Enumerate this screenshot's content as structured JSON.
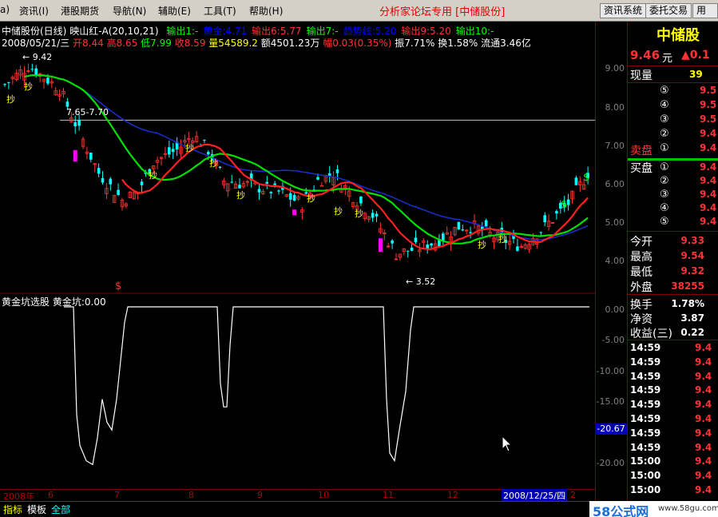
{
  "menu": {
    "items": [
      "a)",
      "资讯(I)",
      "港股期货",
      "导航(N)",
      "辅助(E)",
      "工具(T)",
      "帮助(H)"
    ],
    "forum_title": "分析家论坛专用 [中储股份]",
    "buttons": [
      "资讯系统",
      "委托交易",
      "用户"
    ]
  },
  "header": {
    "stock_name": "中储股份(日线)",
    "indicator_name": "映山红-A(20,10,21)",
    "outputs": [
      {
        "label": "输出1:-",
        "color": "#00ff00"
      },
      {
        "label": "黄金:4.71",
        "color": "#0000ff"
      },
      {
        "label": "输出6:5.77",
        "color": "#ff3333"
      },
      {
        "label": "输出7:-",
        "color": "#00ff00"
      },
      {
        "label": "趋势线:5.20",
        "color": "#0000ff"
      },
      {
        "label": "输出9:5.20",
        "color": "#ff3333"
      },
      {
        "label": "输出10:-",
        "color": "#00ff00"
      }
    ],
    "date": "2008/05/21/三",
    "open": "开8.44",
    "high": "高8.65",
    "low": "低7.99",
    "close": "收8.59",
    "volume": "量54589.2",
    "amount": "额4501.23万",
    "change": "幅0.03(0.35%)",
    "amplitude": "振7.71%",
    "turnover": "换1.58%",
    "float_shares": "流通3.46亿"
  },
  "price_chart": {
    "y_ticks": [
      "9.00",
      "8.00",
      "7.00",
      "6.00",
      "5.00",
      "4.00"
    ],
    "high_label": "9.42",
    "low_label": "3.52",
    "range_label": "7.65-7.70",
    "signal_text": "抄",
    "dollar": "$"
  },
  "indicator": {
    "title": "黄金坑选股",
    "value_label": "黄金坑:0.00",
    "y_ticks": [
      "0.00",
      "-5.00",
      "-10.00",
      "-15.00",
      "-20.00"
    ],
    "current_value": "-20.67"
  },
  "x_axis": {
    "labels": [
      "2008年",
      "6",
      "7",
      "8",
      "9",
      "10",
      "11",
      "12",
      "2"
    ],
    "cursor_date": "2008/12/25/四"
  },
  "bottom": {
    "tabs": [
      "指标",
      "模板",
      "全部"
    ],
    "watermark": "58公式网",
    "watermark_url": "www.58gu.com"
  },
  "quote": {
    "name": "中储股",
    "price": "9.46",
    "price_unit": "元",
    "change": "▲0.1",
    "current_vol_label": "现量",
    "current_vol": "39",
    "sell_label": "卖盘",
    "buy_label": "买盘",
    "sell_levels": [
      {
        "idx": "⑤",
        "price": "9.5"
      },
      {
        "idx": "④",
        "price": "9.5"
      },
      {
        "idx": "③",
        "price": "9.5"
      },
      {
        "idx": "②",
        "price": "9.4"
      },
      {
        "idx": "①",
        "price": "9.4"
      }
    ],
    "buy_levels": [
      {
        "idx": "①",
        "price": "9.4"
      },
      {
        "idx": "②",
        "price": "9.4"
      },
      {
        "idx": "③",
        "price": "9.4"
      },
      {
        "idx": "④",
        "price": "9.4"
      },
      {
        "idx": "⑤",
        "price": "9.4"
      }
    ],
    "stats": [
      {
        "label": "今开",
        "value": "9.33",
        "color": "#ff3333"
      },
      {
        "label": "最高",
        "value": "9.54",
        "color": "#ff3333"
      },
      {
        "label": "最低",
        "value": "9.32",
        "color": "#ff3333"
      },
      {
        "label": "外盘",
        "value": "38255",
        "color": "#ff3333"
      }
    ],
    "stats2": [
      {
        "label": "换手",
        "value": "1.78%"
      },
      {
        "label": "净资",
        "value": "3.87"
      },
      {
        "label": "收益(三)",
        "value": "0.22"
      }
    ],
    "ticks": [
      {
        "time": "14:59",
        "price": "9.4"
      },
      {
        "time": "14:59",
        "price": "9.4"
      },
      {
        "time": "14:59",
        "price": "9.4"
      },
      {
        "time": "14:59",
        "price": "9.4"
      },
      {
        "time": "14:59",
        "price": "9.4"
      },
      {
        "time": "14:59",
        "price": "9.4"
      },
      {
        "time": "14:59",
        "price": "9.4"
      },
      {
        "time": "14:59",
        "price": "9.4"
      },
      {
        "time": "15:00",
        "price": "9.4"
      },
      {
        "time": "15:00",
        "price": "9.4"
      },
      {
        "time": "15:00",
        "price": "9.4"
      }
    ]
  }
}
